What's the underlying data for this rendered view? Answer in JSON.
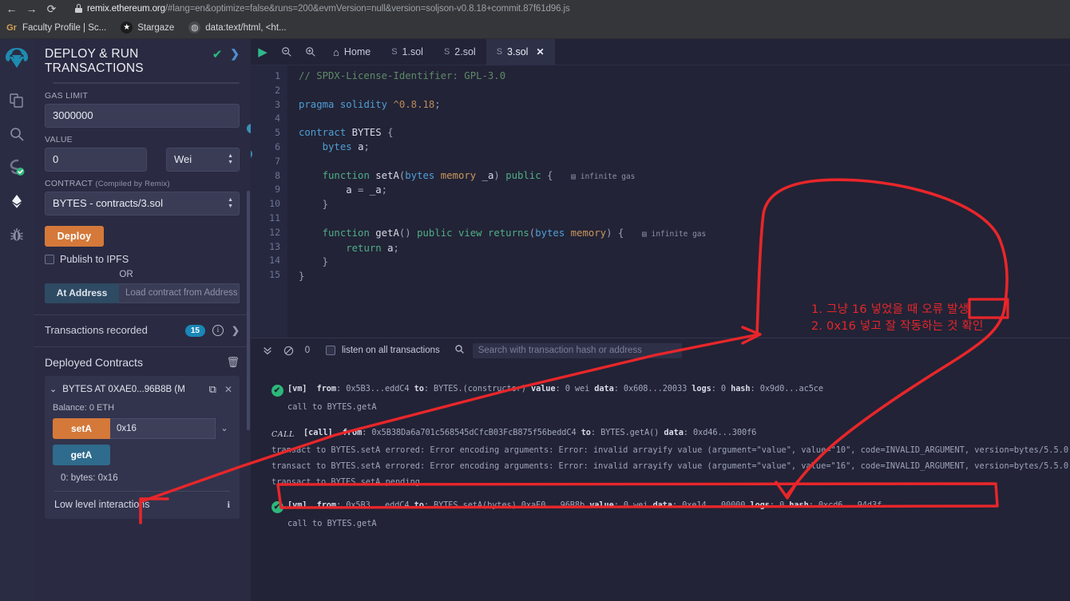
{
  "browser": {
    "nav": {
      "back": "←",
      "forward": "→",
      "reload": "⟳"
    },
    "url_domain": "remix.ethereum.org",
    "url_rest": "/#lang=en&optimize=false&runs=200&evmVersion=null&version=soljson-v0.8.18+commit.87f61d96.js",
    "bookmarks": [
      {
        "icon": "gr-icon",
        "label": "Faculty Profile | Sc..."
      },
      {
        "icon": "star-icon",
        "label": "Stargaze"
      },
      {
        "icon": "globe-icon",
        "label": "data:text/html, <ht..."
      }
    ]
  },
  "rail": {
    "items": [
      {
        "name": "remix-logo",
        "glyph": "◉"
      },
      {
        "name": "file-explorer-icon",
        "glyph": "❐"
      },
      {
        "name": "search-icon",
        "glyph": "🔍"
      },
      {
        "name": "solidity-compiler-icon",
        "glyph": "S"
      },
      {
        "name": "deploy-run-icon",
        "glyph": "◆"
      },
      {
        "name": "debugger-icon",
        "glyph": "🐞"
      }
    ]
  },
  "panel": {
    "title": "DEPLOY & RUN TRANSACTIONS",
    "check_glyph": "✔",
    "chevron_glyph": "❯",
    "gas_limit_label": "GAS LIMIT",
    "gas_limit_value": "3000000",
    "value_label": "VALUE",
    "value_value": "0",
    "value_unit": "Wei",
    "contract_label": "CONTRACT",
    "contract_sublabel": "(Compiled by Remix)",
    "contract_value": "BYTES - contracts/3.sol",
    "deploy_button": "Deploy",
    "publish_ipfs": "Publish to IPFS",
    "or": "OR",
    "at_address_button": "At Address",
    "at_address_placeholder": "Load contract from Address",
    "transactions_recorded_label": "Transactions recorded",
    "transactions_recorded_count": "15",
    "deployed_contracts_label": "Deployed Contracts",
    "contract_instance": "BYTES AT 0XAE0...96B8B (M",
    "balance": "Balance: 0 ETH",
    "fn_setA": "setA",
    "fn_setA_input": "0x16",
    "fn_getA": "getA",
    "return_value": "0: bytes: 0x16",
    "low_level_interactions": "Low level interactions"
  },
  "editor": {
    "toolbar": {
      "run_glyph": "▶",
      "zoom_out_glyph": "⊖",
      "zoom_in_glyph": "⊕",
      "home_label": "Home"
    },
    "tabs": [
      {
        "label": "1.sol",
        "active": false
      },
      {
        "label": "2.sol",
        "active": false
      },
      {
        "label": "3.sol",
        "active": true,
        "close_glyph": "✕"
      }
    ],
    "line_numbers": [
      "1",
      "2",
      "3",
      "4",
      "5",
      "6",
      "7",
      "8",
      "9",
      "10",
      "11",
      "12",
      "13",
      "14",
      "15"
    ],
    "lines": [
      {
        "n": 1,
        "html": "<span class='k-com'>// SPDX-License-Identifier: GPL-3.0</span>"
      },
      {
        "n": 2,
        "html": ""
      },
      {
        "n": 3,
        "html": "<span class='k-kw'>pragma</span> <span class='k-kw'>solidity</span> <span class='k-num'>^0.8.18</span><span class='k-pun'>;</span>"
      },
      {
        "n": 4,
        "html": ""
      },
      {
        "n": 5,
        "html": "<span class='k-kw'>contract</span> <span class='k-id'>BYTES</span> <span class='k-pun'>{</span>"
      },
      {
        "n": 6,
        "html": "    <span class='k-typ'>bytes</span> <span class='k-id'>a</span><span class='k-pun'>;</span>"
      },
      {
        "n": 7,
        "html": ""
      },
      {
        "n": 8,
        "html": "    <span class='k-grn'>function</span> <span class='k-id'>setA</span><span class='k-pun'>(</span><span class='k-typ'>bytes</span> <span class='k-org'>memory</span> <span class='k-id'>_a</span><span class='k-pun'>)</span> <span class='k-grn'>public</span> <span class='k-pun'>{</span>",
        "gas": "infinite gas"
      },
      {
        "n": 9,
        "html": "        <span class='k-id'>a</span> <span class='k-pun'>=</span> <span class='k-id'>_a</span><span class='k-pun'>;</span>"
      },
      {
        "n": 10,
        "html": "    <span class='k-pun'>}</span>"
      },
      {
        "n": 11,
        "html": ""
      },
      {
        "n": 12,
        "html": "    <span class='k-grn'>function</span> <span class='k-id'>getA</span><span class='k-pun'>()</span> <span class='k-grn'>public</span> <span class='k-grn'>view</span> <span class='k-grn'>returns</span><span class='k-pun'>(</span><span class='k-typ'>bytes</span> <span class='k-org'>memory</span><span class='k-pun'>)</span> <span class='k-pun'>{</span>",
        "gas": "infinite gas"
      },
      {
        "n": 13,
        "html": "        <span class='k-grn'>return</span> <span class='k-id'>a</span><span class='k-pun'>;</span>"
      },
      {
        "n": 14,
        "html": "    <span class='k-pun'>}</span>"
      },
      {
        "n": 15,
        "html": "<span class='k-pun'>}</span>"
      }
    ]
  },
  "terminal": {
    "collapse_glyph": "⌄⌄",
    "clear_glyph": "🚫",
    "pending_count": "0",
    "listen_label": "listen on all transactions",
    "search_glyph": "🔍",
    "search_placeholder": "Search with transaction hash or address",
    "entries": [
      {
        "kind": "vm-success",
        "tag": "[vm]",
        "text": "from: 0x5B3...eddC4 to: BYTES.(constructor) value: 0 wei data: 0x608...20033 logs: 0 hash: 0x9d0...ac5ce",
        "sub": "call to BYTES.getA"
      },
      {
        "kind": "call",
        "tag_label": "CALL",
        "tag": "[call]",
        "text": "from: 0x5B38Da6a701c568545dCfcB03FcB875f56beddC4 to: BYTES.getA() data: 0xd46...300f6"
      },
      {
        "kind": "plain",
        "text": "transact to BYTES.setA errored: Error encoding arguments: Error: invalid arrayify value (argument=\"value\", value=\"10\", code=INVALID_ARGUMENT, version=bytes/5.5.0)"
      },
      {
        "kind": "plain",
        "text": "transact to BYTES.setA errored: Error encoding arguments: Error: invalid arrayify value (argument=\"value\", value=\"16\", code=INVALID_ARGUMENT, version=bytes/5.5.0)"
      },
      {
        "kind": "plain",
        "text": "transact to BYTES.setA pending ..."
      },
      {
        "kind": "vm-success",
        "tag": "[vm]",
        "text": "from: 0x5B3...eddC4 to: BYTES.setA(bytes) 0xaE0...96B8b value: 0 wei data: 0xe14...00000 logs: 0 hash: 0xcd6...94d3f",
        "sub": "call to BYTES.getA"
      }
    ]
  },
  "annotations": {
    "ink_color": "#e8262a",
    "note_line1": "1. 그냥 16 넣었을 때 오류 발생",
    "note_line2": "2. 0x16 넣고 잘 작동하는 것 확인"
  }
}
